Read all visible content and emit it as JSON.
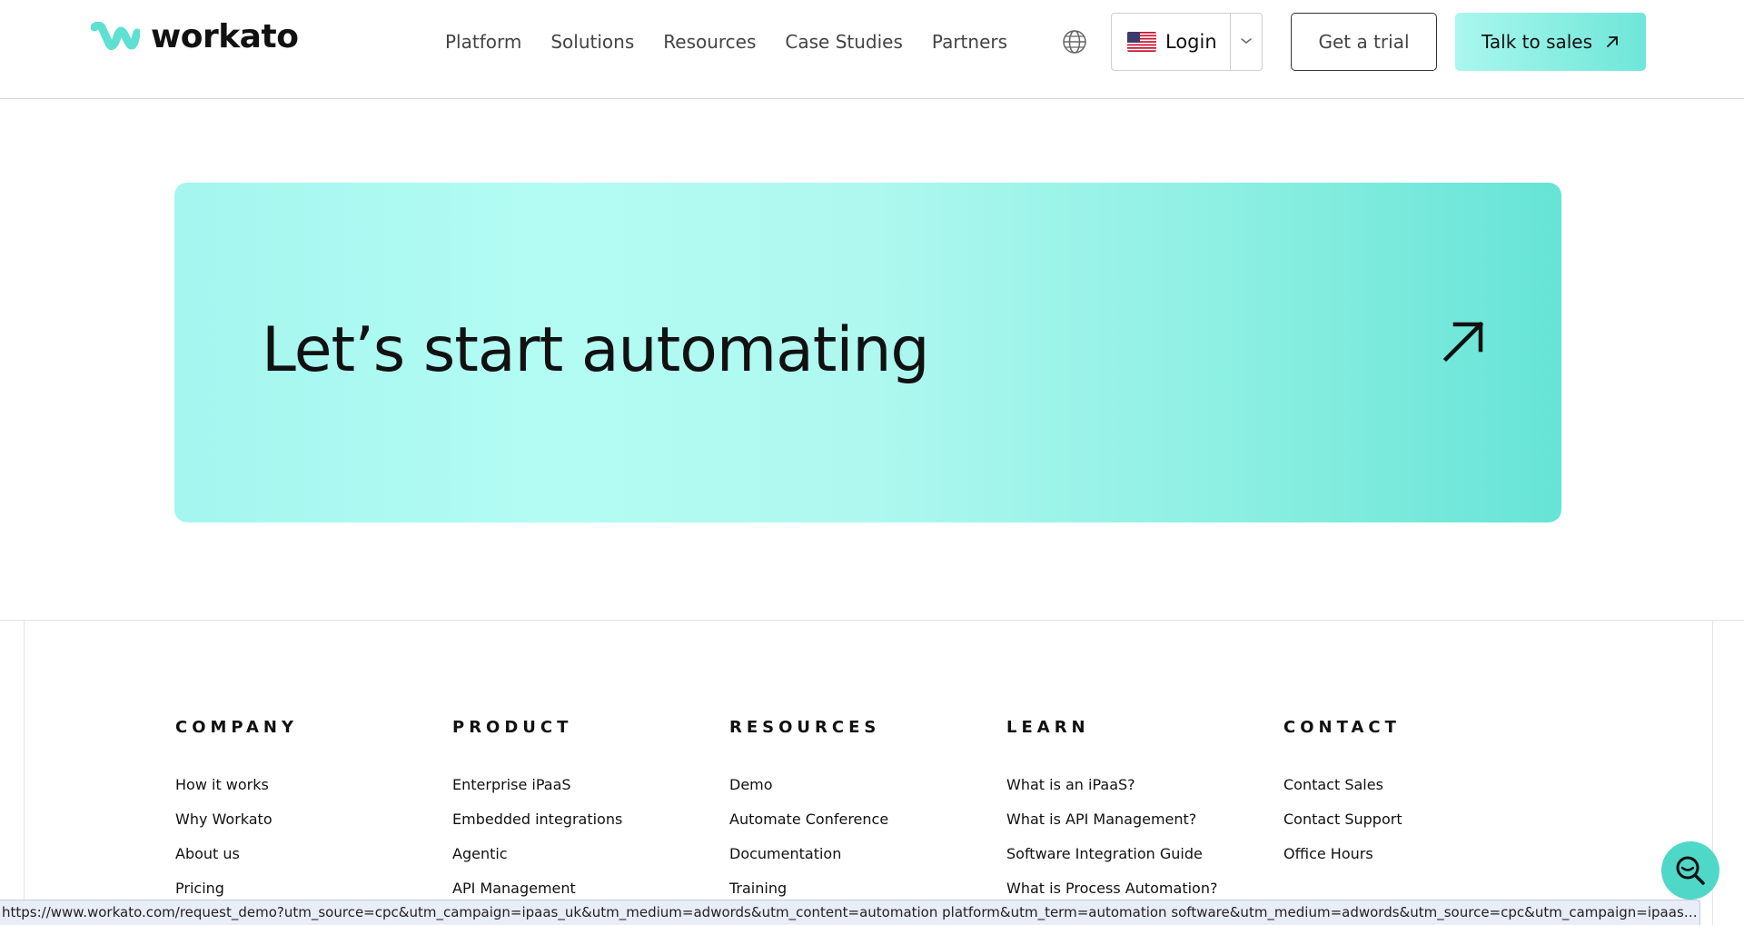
{
  "header": {
    "logo_text": "workato",
    "nav": [
      "Platform",
      "Solutions",
      "Resources",
      "Case Studies",
      "Partners"
    ],
    "login_label": "Login",
    "trial_label": "Get a trial",
    "sales_label": "Talk to sales"
  },
  "cta": {
    "title": "Let’s start automating"
  },
  "footer": {
    "columns": [
      {
        "heading": "COMPANY",
        "items": [
          "How it works",
          "Why Workato",
          "About us",
          "Pricing"
        ]
      },
      {
        "heading": "PRODUCT",
        "items": [
          "Enterprise iPaaS",
          "Embedded integrations",
          "Agentic",
          "API Management"
        ]
      },
      {
        "heading": "RESOURCES",
        "items": [
          "Demo",
          "Automate Conference",
          "Documentation",
          "Training"
        ]
      },
      {
        "heading": "LEARN",
        "items": [
          "What is an iPaaS?",
          "What is API Management?",
          "Software Integration Guide",
          "What is Process Automation?"
        ]
      },
      {
        "heading": "CONTACT",
        "items": [
          "Contact Sales",
          "Contact Support",
          "Office Hours"
        ]
      }
    ]
  },
  "status_url": "https://www.workato.com/request_demo?utm_source=cpc&utm_campaign=ipaas_uk&utm_medium=adwords&utm_content=automation platform&utm_term=automation software&utm_medium=adwords&utm_source=cpc&utm_campaign=ipaas_...",
  "colors": {
    "brand_teal": "#5ee0d2",
    "cta_light": "#b3fcf4",
    "cta_dark": "#66e4d6",
    "statusbar_bg": "#e8edf7"
  },
  "icons": [
    "workato-logo-icon",
    "globe-icon",
    "us-flag-icon",
    "chevron-down-icon",
    "arrow-up-right-icon",
    "chat-search-icon"
  ]
}
